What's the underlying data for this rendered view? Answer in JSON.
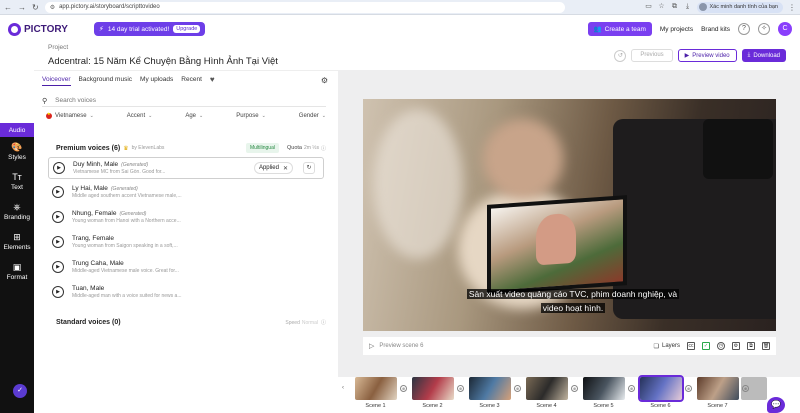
{
  "browser": {
    "url": "app.pictory.ai/storyboard/scripttovideo",
    "profile_label": "Xác minh danh tính của bạn"
  },
  "header": {
    "logo": "PICTORY",
    "trial": "14 day trial activated!",
    "upgrade": "Upgrade",
    "create_team": "Create a team",
    "my_projects": "My projects",
    "brand_kits": "Brand kits",
    "avatar_initial": "C",
    "accent_color": "#6a2bd9"
  },
  "project": {
    "label": "Project",
    "title": "Adcentral: 15 Năm Kể Chuyện Bằng Hình Ảnh Tại Việt",
    "previous": "Previous",
    "preview_video": "Preview video",
    "download": "Download"
  },
  "sidebar": {
    "items": [
      {
        "label": "Audio",
        "icon": "music-icon"
      },
      {
        "label": "Styles",
        "icon": "palette-icon"
      },
      {
        "label": "Text",
        "icon": "text-icon"
      },
      {
        "label": "Branding",
        "icon": "branding-icon"
      },
      {
        "label": "Elements",
        "icon": "elements-icon"
      },
      {
        "label": "Format",
        "icon": "format-icon"
      }
    ]
  },
  "panel": {
    "tabs": [
      "Voiceover",
      "Background music",
      "My uploads",
      "Recent"
    ],
    "search_placeholder": "Search voices",
    "filters": {
      "language": "Vietnamese",
      "accent": "Accent",
      "age": "Age",
      "purpose": "Purpose",
      "gender": "Gender"
    },
    "premium_title": "Premium voices (6)",
    "premium_by": "by ElevenLabs",
    "multilingual": "Multilingual",
    "quota_label": "Quota",
    "quota_value": "2m ½s",
    "voices": [
      {
        "name": "Duy Minh, Male",
        "tag": "(Generated)",
        "desc": "Vietnamese MC from Sai Gòn. Good for...",
        "applied": true
      },
      {
        "name": "Ly Hai, Male",
        "tag": "(Generated)",
        "desc": "Middle aged southern accent Vietnamese male,..."
      },
      {
        "name": "Nhung, Female",
        "tag": "(Generated)",
        "desc": "Young woman from Hanoi with a Northern acce..."
      },
      {
        "name": "Trang, Female",
        "tag": "",
        "desc": "Young woman from Saigon speaking in a soft,..."
      },
      {
        "name": "Trung Caha, Male",
        "tag": "",
        "desc": "Middle-aged Vietnamese male voice. Great for..."
      },
      {
        "name": "Tuan, Male",
        "tag": "",
        "desc": "Middle-aged man with a voice suited for news a..."
      }
    ],
    "applied_label": "Applied",
    "standard_title": "Standard voices (0)",
    "speed_label": "Speed",
    "speed_value": "Normal"
  },
  "video": {
    "subtitle_line1": "Sản xuất video quảng cáo TVC, phim doanh nghiệp, và",
    "subtitle_line2": "video hoạt hình.",
    "preview_scene": "Preview scene 6",
    "layers": "Layers"
  },
  "scenes": [
    {
      "label": "Scene 1",
      "thumb": "t1"
    },
    {
      "label": "Scene 2",
      "thumb": "t2"
    },
    {
      "label": "Scene 3",
      "thumb": "t3"
    },
    {
      "label": "Scene 4",
      "thumb": "t4"
    },
    {
      "label": "Scene 5",
      "thumb": "t5"
    },
    {
      "label": "Scene 6",
      "thumb": "t6",
      "selected": true
    },
    {
      "label": "Scene 7",
      "thumb": "t7"
    }
  ]
}
